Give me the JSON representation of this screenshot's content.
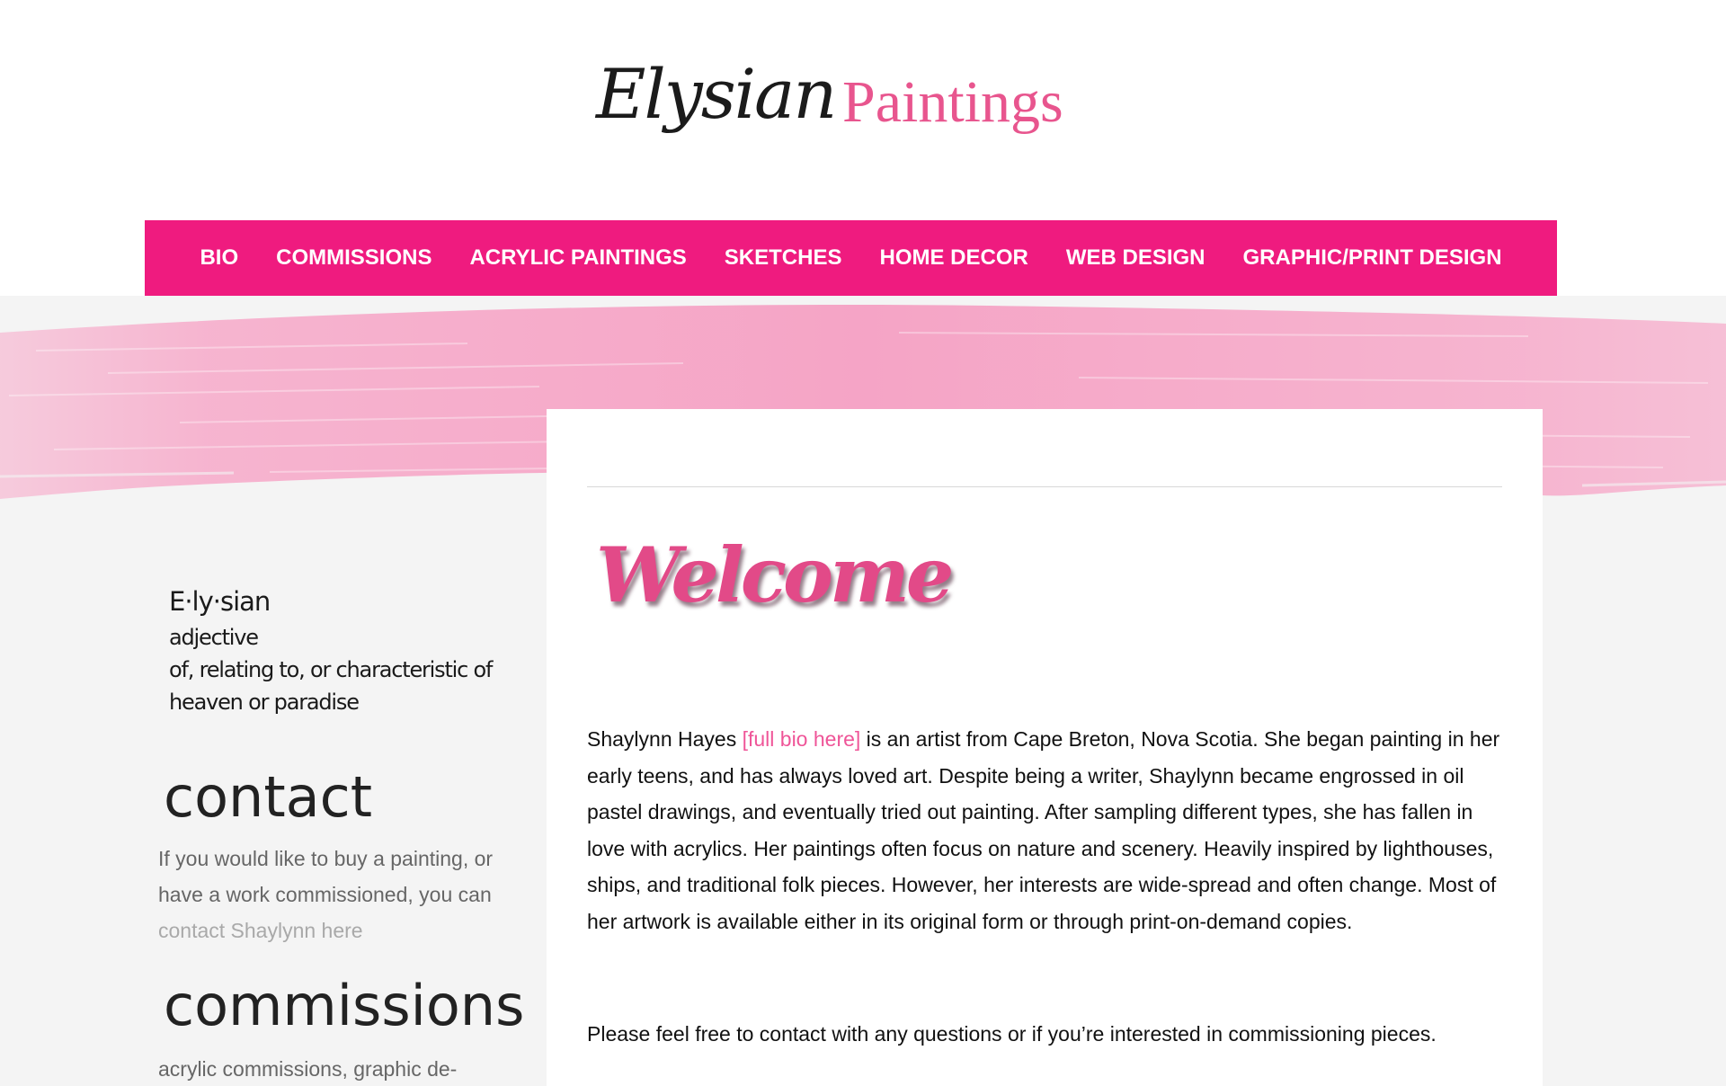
{
  "logo": {
    "script_text": "Elysian",
    "serif_text": "Paintings"
  },
  "nav": {
    "items": [
      {
        "label": "BIO"
      },
      {
        "label": "COMMISSIONS"
      },
      {
        "label": "ACRYLIC PAINTINGS"
      },
      {
        "label": "SKETCHES"
      },
      {
        "label": "HOME DECOR"
      },
      {
        "label": "WEB DESIGN"
      },
      {
        "label": "GRAPHIC/PRINT DESIGN"
      }
    ]
  },
  "sidebar": {
    "definition": {
      "word": "E·ly·sian",
      "part_of_speech": "adjective",
      "line1": "of,  relating to,  or characteristic of",
      "line2": "heaven or paradise"
    },
    "contact": {
      "heading": "contact",
      "text_before": "If you would like to buy a painting, or have a work commissioned, you can ",
      "link": "contact Shaylynn here"
    },
    "commissions": {
      "heading": "commissions",
      "text": "acrylic commissions, graphic de-"
    }
  },
  "main": {
    "welcome": "Welcome",
    "bio": {
      "name": "Shaylynn Hayes ",
      "link": "[full bio here]",
      "text": " is an artist from Cape Breton, Nova Scotia. She began painting in her early teens, and has always loved art. Despite being a writer, Shaylynn became engrossed in oil pastel drawings, and eventually tried out painting. After sampling different types, she has fallen in love with acrylics. Her paintings often focus on nature and scenery. Heavily inspired by lighthouses, ships, and traditional folk pieces. However, her interests are wide-spread and often change. Most of her artwork is available either in its original form or through print-on-demand copies."
    },
    "contact_note": "Please feel free to contact with any questions or if you’re interested in commissioning pieces."
  },
  "colors": {
    "nav_bg": "#ef1b7f",
    "accent_pink": "#e8558e",
    "brush_pink": "#f7a9c9",
    "page_bg": "#f4f4f4"
  }
}
